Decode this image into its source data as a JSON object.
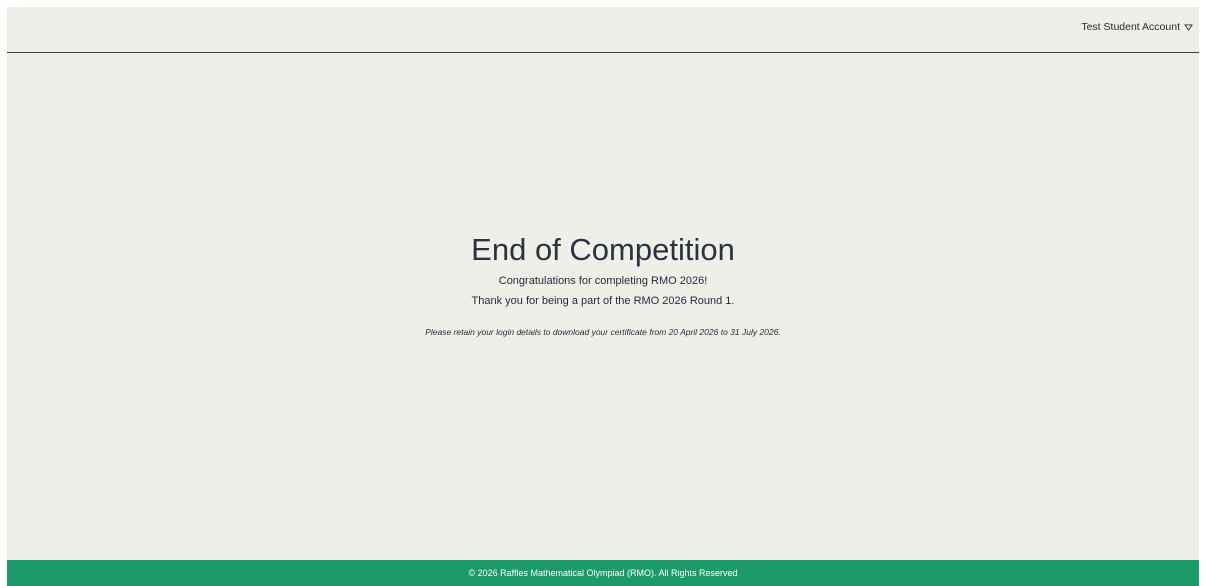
{
  "header": {
    "account_label": "Test Student Account"
  },
  "main": {
    "title": "End of Competition",
    "congrats": "Congratulations for completing RMO 2026!",
    "thanks": "Thank you for being a part of the RMO 2026 Round 1.",
    "note": "Please retain your login details to download your certificate from 20 April 2026 to 31 July 2026."
  },
  "footer": {
    "text": "© 2026 Raffles Mathematical Olympiad (RMO). All Rights Reserved"
  },
  "colors": {
    "background": "#efefea",
    "footer": "#1c9a6c",
    "text": "#1f2a37"
  },
  "icons": {
    "account_caret": "chevron-down-icon"
  }
}
